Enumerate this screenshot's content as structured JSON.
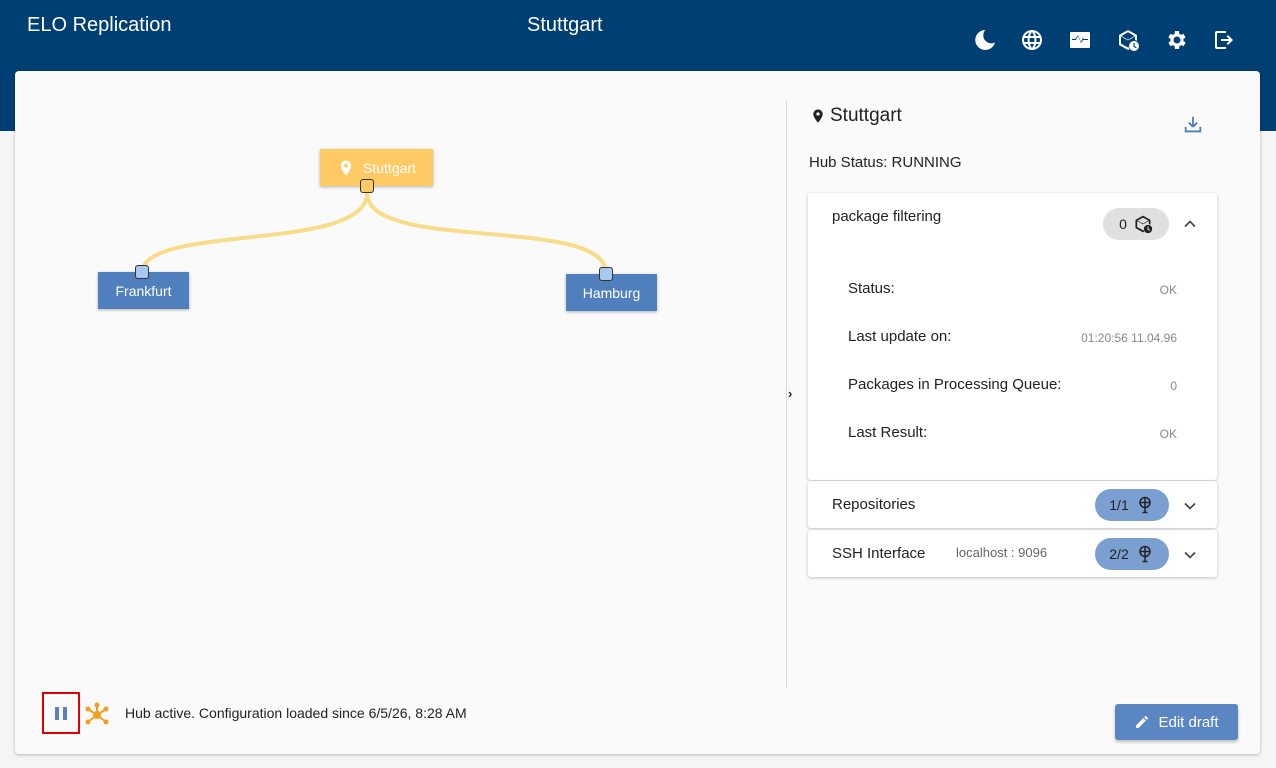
{
  "app": {
    "title": "ELO Replication",
    "page_heading": "Stuttgart"
  },
  "toolbar": {
    "icons": [
      "dark-mode-icon",
      "globe-icon",
      "monitor-pulse-icon",
      "package-clock-icon",
      "settings-gear-icon",
      "logout-icon"
    ]
  },
  "graph": {
    "root": {
      "label": "Stuttgart"
    },
    "children": [
      {
        "label": "Frankfurt"
      },
      {
        "label": "Hamburg"
      }
    ],
    "colors": {
      "root": "#fdca63",
      "child": "#4f7fbd",
      "edge": "#f8dc8a"
    }
  },
  "panel": {
    "title": "Stuttgart",
    "hub_status": "Hub Status: RUNNING",
    "package_filtering": {
      "title": "package filtering",
      "count": "0",
      "rows": [
        {
          "label": "Status:",
          "value": "OK"
        },
        {
          "label": "Last update on:",
          "value": "01:20:56 11.04.96"
        },
        {
          "label": "Packages in Processing Queue:",
          "value": "0"
        },
        {
          "label": "Last Result:",
          "value": "OK"
        }
      ]
    },
    "repositories": {
      "title": "Repositories",
      "count": "1/1"
    },
    "ssh": {
      "title": "SSH Interface",
      "host": "localhost : 9096",
      "count": "2/2"
    }
  },
  "footer": {
    "status": "Hub active. Configuration loaded since 6/5/26, 8:28 AM",
    "edit_label": "Edit draft"
  }
}
